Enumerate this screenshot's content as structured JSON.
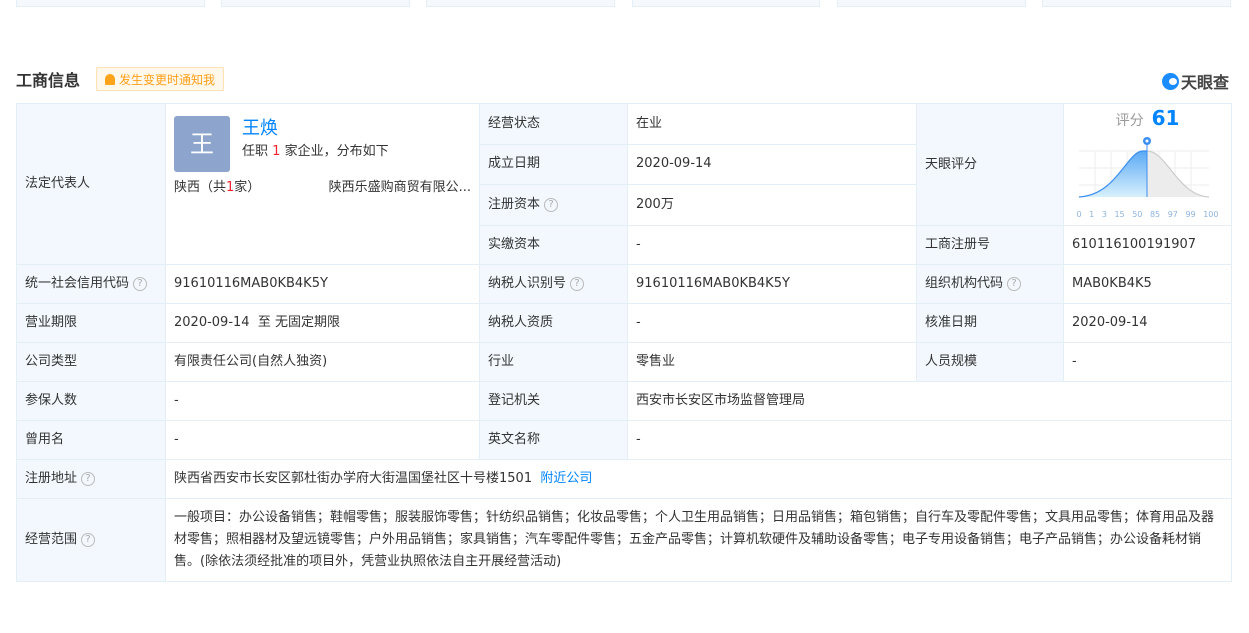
{
  "header": {
    "title": "工商信息",
    "notify": "发生变更时通知我",
    "logo": "天眼查"
  },
  "legal_rep": {
    "label": "法定代表人",
    "avatar_char": "王",
    "name": "王焕",
    "desc_pre": "任职",
    "count": "1",
    "desc_post": "家企业，分布如下",
    "region_pre": "陕西（共",
    "region_count": "1",
    "region_post": "家）",
    "company": "陕西乐盛购商贸有限公..."
  },
  "rows": {
    "status": {
      "label": "经营状态",
      "value": "在业"
    },
    "founded": {
      "label": "成立日期",
      "value": "2020-09-14"
    },
    "capital": {
      "label": "注册资本",
      "value": "200万"
    },
    "paid": {
      "label": "实缴资本",
      "value": "-"
    },
    "score": {
      "label": "天眼评分",
      "score_label": "评分",
      "score": "61",
      "ticks": [
        "0",
        "1",
        "3",
        "15",
        "50",
        "85",
        "97",
        "99",
        "100"
      ]
    },
    "regno": {
      "label": "工商注册号",
      "value": "610116100191907"
    },
    "credit": {
      "label": "统一社会信用代码",
      "value": "91610116MAB0KB4K5Y"
    },
    "taxid": {
      "label": "纳税人识别号",
      "value": "91610116MAB0KB4K5Y"
    },
    "orgcode": {
      "label": "组织机构代码",
      "value": "MAB0KB4K5"
    },
    "term": {
      "label": "营业期限",
      "value": "2020-09-14  至 无固定期限"
    },
    "taxq": {
      "label": "纳税人资质",
      "value": "-"
    },
    "approve": {
      "label": "核准日期",
      "value": "2020-09-14"
    },
    "type": {
      "label": "公司类型",
      "value": "有限责任公司(自然人独资)"
    },
    "industry": {
      "label": "行业",
      "value": "零售业"
    },
    "staff": {
      "label": "人员规模",
      "value": "-"
    },
    "insured": {
      "label": "参保人数",
      "value": "-"
    },
    "authority": {
      "label": "登记机关",
      "value": "西安市长安区市场监督管理局"
    },
    "oldname": {
      "label": "曾用名",
      "value": "-"
    },
    "enname": {
      "label": "英文名称",
      "value": "-"
    },
    "address": {
      "label": "注册地址",
      "value": "陕西省西安市长安区郭杜街办学府大街温国堡社区十号楼1501",
      "link": "附近公司"
    },
    "scope": {
      "label": "经营范围",
      "value": "一般项目：办公设备销售；鞋帽零售；服装服饰零售；针纺织品销售；化妆品零售；个人卫生用品销售；日用品销售；箱包销售；自行车及零配件零售；文具用品零售；体育用品及器材零售；照相器材及望远镜零售；户外用品销售；家具销售；汽车零配件零售；五金产品零售；计算机软硬件及辅助设备零售；电子专用设备销售；电子产品销售；办公设备耗材销售。(除依法须经批准的项目外，凭营业执照依法自主开展经营活动)"
    }
  }
}
